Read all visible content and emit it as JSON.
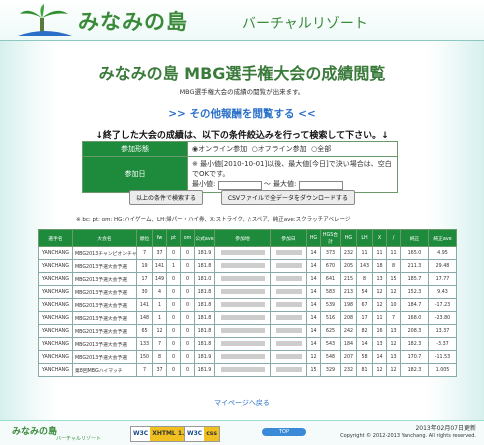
{
  "header": {
    "title": "みなみの島",
    "subtitle": "バーチャルリゾート"
  },
  "main": {
    "title": "みなみの島 MBG選手権大会の成績閲覧",
    "lead": "MBG選手権大会の成績の閲覧が出来ます。",
    "other_link": ">> その他報酬を閲覧する <<",
    "note": "↓終了した大会の成績は、以下の条件絞込みを行って検索して下さい。↓"
  },
  "filter": {
    "mode_label": "参加形態",
    "mode_options": [
      "オンライン参加",
      "オフライン参加",
      "全部"
    ],
    "date_label": "参加日",
    "date_hint": "※ 最小値[2010-10-01]以後、最大値[今日]で決い場合は、空白でOKです。",
    "min_label": "最小値:",
    "max_label": "～ 最大値:"
  },
  "buttons": {
    "search": "以上の条件で検索する",
    "csv": "CSVファイルで全データをダウンロードする"
  },
  "legend": "※ bc: pt: om: HG:ハイゲーム、LH:帰パー・ハイ券、X:ストライク、/:スペア、純正ave:スクラッチアベレージ",
  "table": {
    "headers": [
      "選手名",
      "大会名",
      "順位",
      "fw",
      "pt",
      "om",
      "公式ave",
      "参加地",
      "参加日",
      "HG",
      "HGS合計",
      "HG",
      "LH",
      "X",
      "/",
      "純正",
      "純正ave"
    ],
    "rows": [
      [
        "YANCHANG",
        "MBG2013チャンピオンチャレンジ",
        "7",
        "37",
        "0",
        "0",
        "181.9",
        "",
        "",
        "14",
        "373",
        "232",
        "11",
        "11",
        "11",
        "165.0",
        "4.95"
      ],
      [
        "YANCHANG",
        "MBG2013予選大会予選",
        "19",
        "141",
        "1",
        "0",
        "181.8",
        "",
        "",
        "14",
        "670",
        "205",
        "143",
        "18",
        "8",
        "211.3",
        "29.48"
      ],
      [
        "YANCHANG",
        "MBG2013予選大会予選",
        "17",
        "149",
        "0",
        "0",
        "181.0",
        "",
        "",
        "14",
        "641",
        "215",
        "8",
        "13",
        "15",
        "185.7",
        "17.77"
      ],
      [
        "YANCHANG",
        "MBG2013予選大会予選",
        "30",
        "4",
        "0",
        "0",
        "181.8",
        "",
        "",
        "14",
        "583",
        "213",
        "54",
        "12",
        "12",
        "152.3",
        "9.43"
      ],
      [
        "YANCHANG",
        "MBG2013予選大会予選",
        "141",
        "1",
        "0",
        "0",
        "181.8",
        "",
        "",
        "14",
        "539",
        "198",
        "67",
        "12",
        "10",
        "184.7",
        "-17.23"
      ],
      [
        "YANCHANG",
        "MBG2013予選大会予選",
        "148",
        "1",
        "0",
        "0",
        "181.8",
        "",
        "",
        "14",
        "516",
        "208",
        "17",
        "11",
        "7",
        "168.0",
        "-23.80"
      ],
      [
        "YANCHANG",
        "MBG2013予選大会予選",
        "65",
        "12",
        "0",
        "0",
        "181.8",
        "",
        "",
        "14",
        "625",
        "242",
        "82",
        "16",
        "13",
        "208.3",
        "13.37"
      ],
      [
        "YANCHANG",
        "MBG2013予選大会予選",
        "133",
        "7",
        "0",
        "0",
        "181.8",
        "",
        "",
        "14",
        "543",
        "184",
        "14",
        "13",
        "12",
        "182.3",
        "-3.37"
      ],
      [
        "YANCHANG",
        "MBG2013予選大会予選",
        "150",
        "8",
        "0",
        "0",
        "181.9",
        "",
        "",
        "12",
        "548",
        "207",
        "58",
        "14",
        "13",
        "170.7",
        "-11.53"
      ],
      [
        "YANCHANG",
        "第8回MBGハイマッチ",
        "7",
        "37",
        "0",
        "0",
        "181.9",
        "",
        "",
        "15",
        "329",
        "232",
        "81",
        "12",
        "12",
        "182.3",
        "1.005"
      ]
    ]
  },
  "mypage": "マイページへ戻る",
  "footer": {
    "logo": "みなみの島",
    "logo_sub": "バーチャルリゾート",
    "badge1": [
      "W3C",
      "XHTML 1.0"
    ],
    "badge2": [
      "W3C",
      "css"
    ],
    "top": "TOP",
    "updated": "2013年02月07日更新",
    "copyright": "Copyright © 2012-2013 Yanchang. All rights reserved."
  }
}
